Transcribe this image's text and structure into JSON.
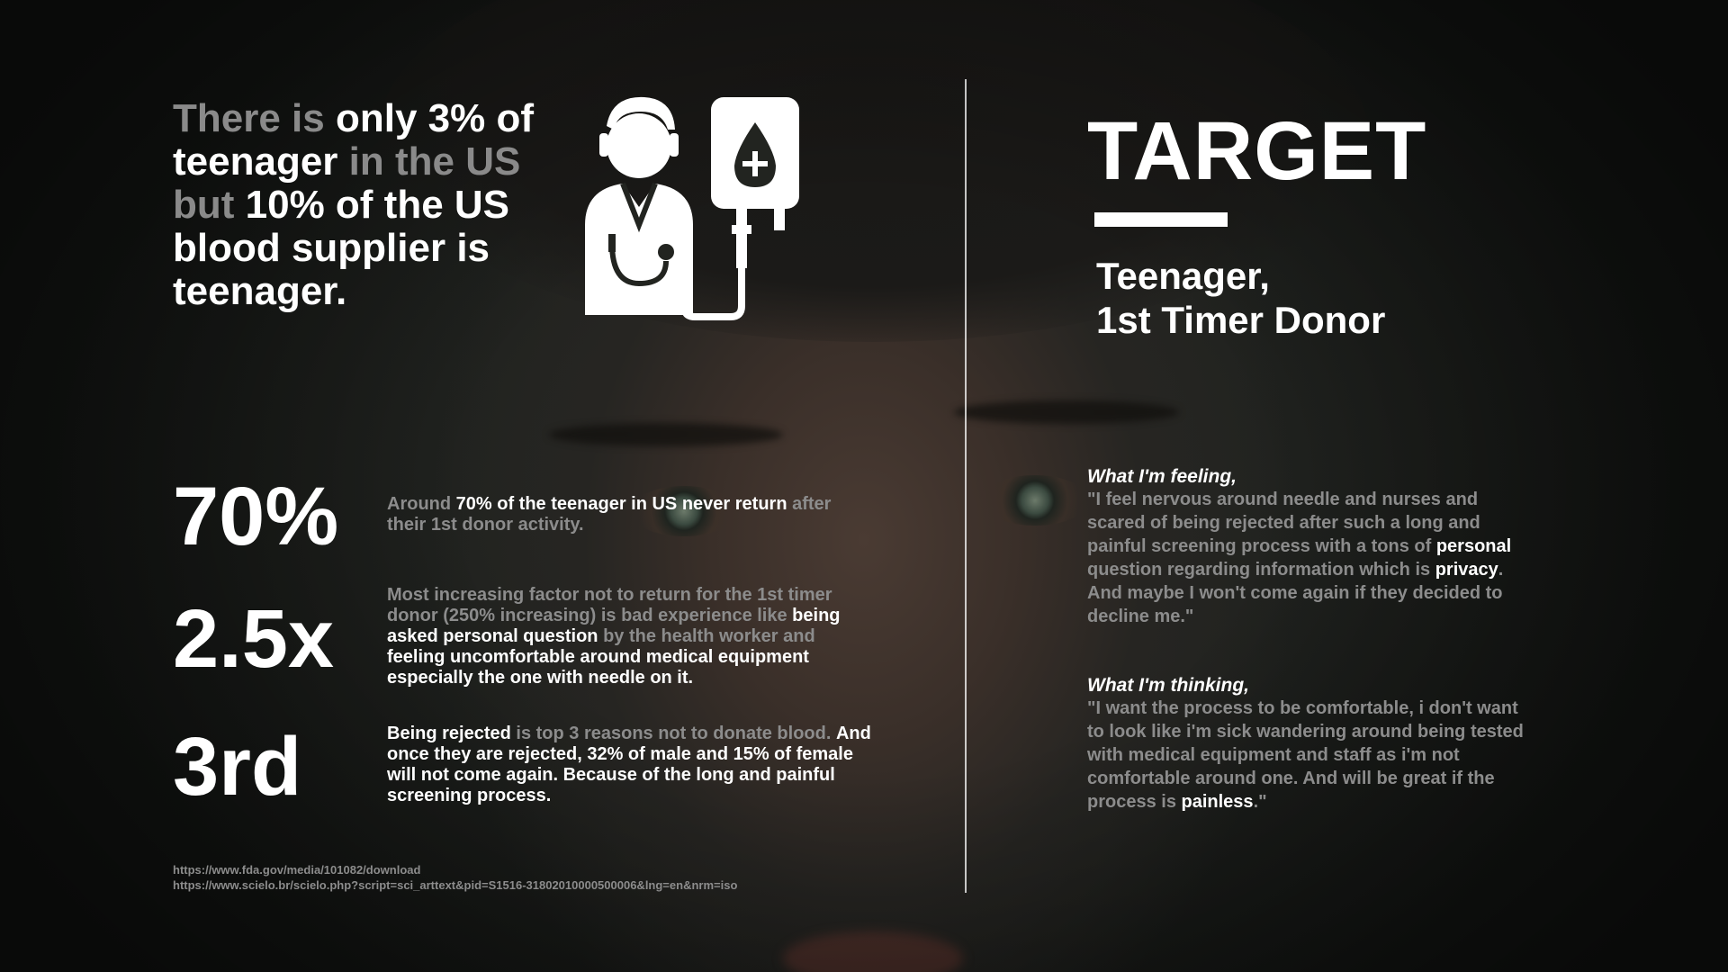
{
  "headline": {
    "part1": "There is",
    "part2": " only 3% of teenager",
    "part3": " in the US but",
    "part4": " 10% of the US blood supplier is teenager."
  },
  "target": {
    "title": "TARGET",
    "subtitle_line1": "Teenager,",
    "subtitle_line2": "1st Timer Donor"
  },
  "stats": [
    {
      "value": "70%",
      "t1": "Around ",
      "t2": "70% of the teenager in US never return",
      "t3": " after their 1st donor activity."
    },
    {
      "value": "2.5x",
      "t1": "Most increasing factor not to return for the 1st timer donor (250% increasing) is bad experience like ",
      "t2": "being asked personal question",
      "t3": " by the health worker and ",
      "t4": "feeling uncomfortable around medical equipment especially the one with needle on it."
    },
    {
      "value": "3rd",
      "t1": "Being rejected",
      "t2": " is top 3 reasons not to donate blood. ",
      "t3": "And once they are rejected, 32% of male and 15% of female will not come again. Because of the long and painful screening process."
    }
  ],
  "feeling": {
    "heading": "What I'm feeling,",
    "q1": "\"I feel nervous around needle and nurses and scared of being rejected after such a long and painful screening process with a tons of ",
    "q2": "personal",
    "q3": " question regarding information which is ",
    "q4": "privacy",
    "q5": ". And maybe I won't come again if they decided to decline me.\""
  },
  "thinking": {
    "heading": "What I'm thinking,",
    "q1": "\"I want the process to be comfortable, i don't want to look like i'm sick wandering around being tested with medical equipment and staff as i'm not comfortable around one. And will be great if the process is ",
    "q2": "painless",
    "q3": ".\""
  },
  "sources": [
    "https://www.fda.gov/media/101082/download",
    "https://www.scielo.br/scielo.php?script=sci_arttext&pid=S1516-31802010000500006&lng=en&nrm=iso"
  ],
  "icons": {
    "doctor": "doctor-blood-bag-icon"
  },
  "colors": {
    "text": "#ffffff",
    "muted": "#8c8c8c",
    "background": "#1a1c1a"
  }
}
